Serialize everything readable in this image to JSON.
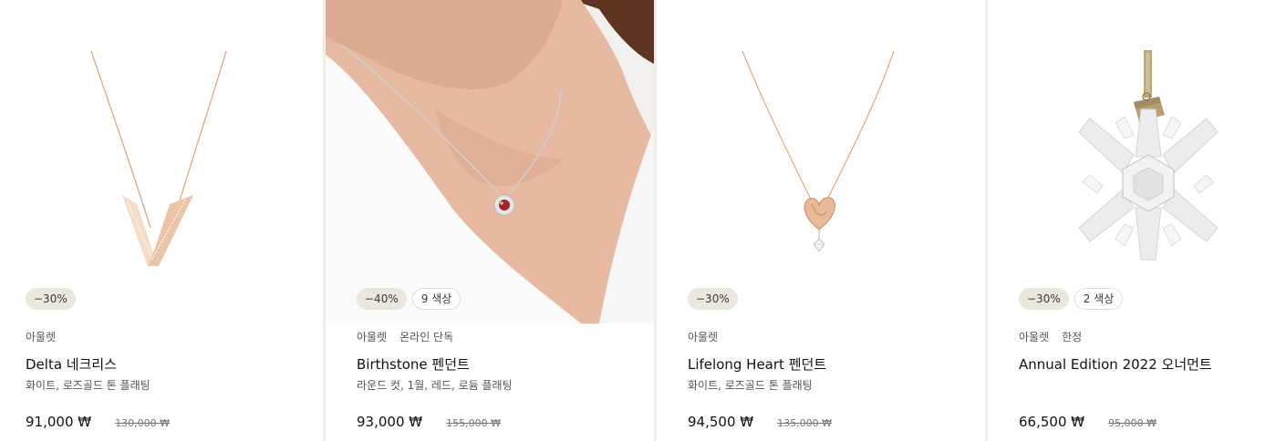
{
  "products": [
    {
      "image": "product-image-delta-necklace",
      "badges": {
        "discount": "−30%",
        "colors": ""
      },
      "tags": [
        "아울렛"
      ],
      "title": "Delta 네크리스",
      "subtitle": "화이트, 로즈골드 톤 플래팅",
      "price": "91,000 ₩",
      "original_price": "130,000 ₩"
    },
    {
      "image": "product-image-model-birthstone-pendant",
      "badges": {
        "discount": "−40%",
        "colors": "9 색상"
      },
      "tags": [
        "아울렛",
        "온라인 단독"
      ],
      "title": "Birthstone 펜던트",
      "subtitle": "라운드 컷, 1월, 레드, 로듐 플래팅",
      "price": "93,000 ₩",
      "original_price": "155,000 ₩"
    },
    {
      "image": "product-image-lifelong-heart-pendant",
      "badges": {
        "discount": "−30%",
        "colors": ""
      },
      "tags": [
        "아울렛"
      ],
      "title": "Lifelong Heart 펜던트",
      "subtitle": "화이트, 로즈골드 톤 플래팅",
      "price": "94,500 ₩",
      "original_price": "135,000 ₩"
    },
    {
      "image": "product-image-snowflake-ornament",
      "badges": {
        "discount": "−30%",
        "colors": "2 색상"
      },
      "tags": [
        "아울렛",
        "한정"
      ],
      "title": "Annual Edition 2022 오너먼트",
      "subtitle": "",
      "price": "66,500 ₩",
      "original_price": "95,000 ₩"
    }
  ],
  "colors": {
    "badge_bg": "#ece7dd",
    "divider": "#f0ede6",
    "rose_gold": "#e3a87e",
    "silver": "#c9c9c9",
    "garnet": "#b32a2a"
  }
}
